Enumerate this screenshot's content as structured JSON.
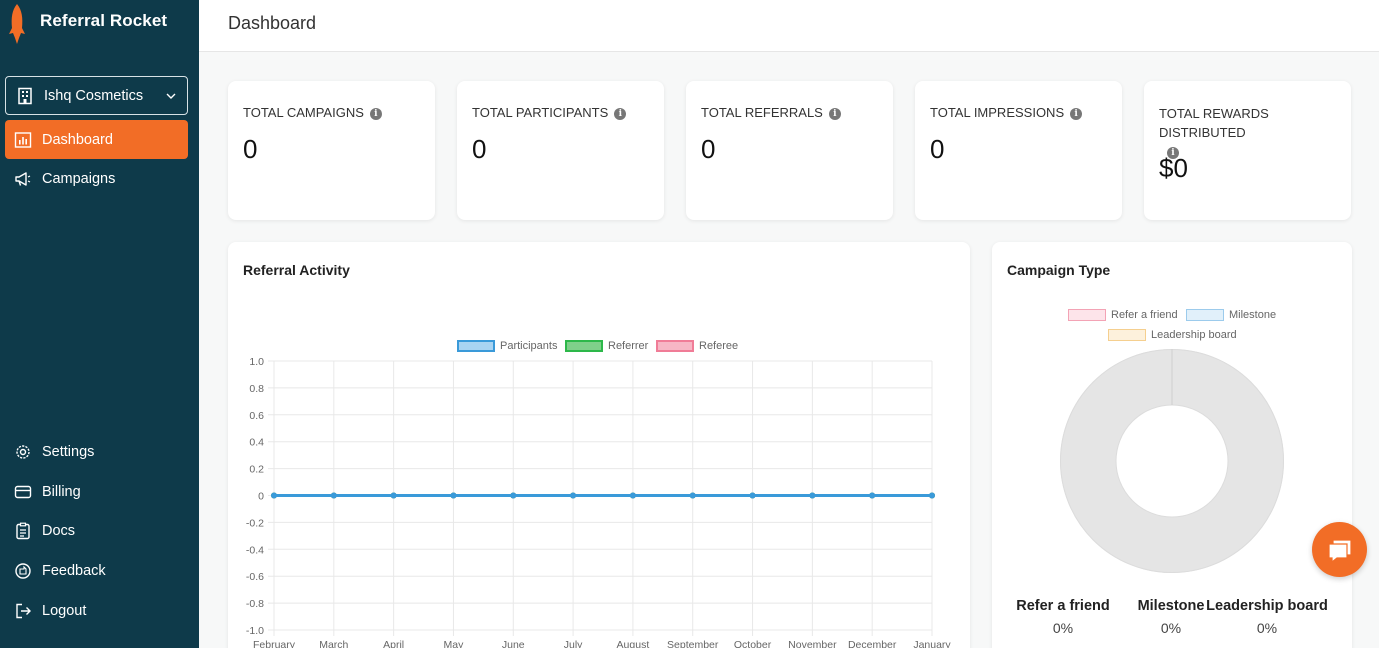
{
  "brand": {
    "name": "Referral Rocket",
    "logo_icon": "rocket-icon",
    "accent": "#f26d26",
    "sidebar_bg": "#0e3a4a"
  },
  "org_selector": {
    "value": "Ishq Cosmetics"
  },
  "nav": {
    "dashboard": "Dashboard",
    "campaigns": "Campaigns",
    "settings": "Settings",
    "billing": "Billing",
    "docs": "Docs",
    "feedback": "Feedback",
    "logout": "Logout"
  },
  "header": {
    "title": "Dashboard"
  },
  "stats": [
    {
      "label": "TOTAL CAMPAIGNS",
      "value": "0"
    },
    {
      "label": "TOTAL PARTICIPANTS",
      "value": "0"
    },
    {
      "label": "TOTAL REFERRALS",
      "value": "0"
    },
    {
      "label": "TOTAL IMPRESSIONS",
      "value": "0"
    },
    {
      "label": "TOTAL REWARDS DISTRIBUTED",
      "value": "$0"
    }
  ],
  "referral_activity": {
    "title": "Referral Activity"
  },
  "campaign_type": {
    "title": "Campaign Type",
    "breakdown": [
      {
        "label": "Refer a friend",
        "value": "0%"
      },
      {
        "label": "Milestone",
        "value": "0%"
      },
      {
        "label": "Leadership board",
        "value": "0%"
      }
    ]
  },
  "chart_data": [
    {
      "type": "line",
      "title": "",
      "categories": [
        "February",
        "March",
        "April",
        "May",
        "June",
        "July",
        "August",
        "September",
        "October",
        "November",
        "December",
        "January"
      ],
      "series": [
        {
          "name": "Participants",
          "color": "#3a9ad9",
          "values": [
            0,
            0,
            0,
            0,
            0,
            0,
            0,
            0,
            0,
            0,
            0,
            0
          ]
        },
        {
          "name": "Referrer",
          "color": "#2db84a",
          "values": [
            0,
            0,
            0,
            0,
            0,
            0,
            0,
            0,
            0,
            0,
            0,
            0
          ]
        },
        {
          "name": "Referee",
          "color": "#f07c97",
          "values": [
            0,
            0,
            0,
            0,
            0,
            0,
            0,
            0,
            0,
            0,
            0,
            0
          ]
        }
      ],
      "yticks": [
        "1.0",
        "0.8",
        "0.6",
        "0.4",
        "0.2",
        "0",
        "-0.2",
        "-0.4",
        "-0.6",
        "-0.8",
        "-1.0"
      ],
      "ylim": [
        -1,
        1
      ],
      "grid": true,
      "legend": "top"
    },
    {
      "type": "pie",
      "title": "",
      "series": [
        {
          "name": "Refer a friend",
          "color": "#f9c9d4",
          "value": 0
        },
        {
          "name": "Milestone",
          "color": "#c5e2f5",
          "value": 0
        },
        {
          "name": "Leadership board",
          "color": "#fbe3bd",
          "value": 0
        }
      ],
      "legend": "top"
    }
  ]
}
